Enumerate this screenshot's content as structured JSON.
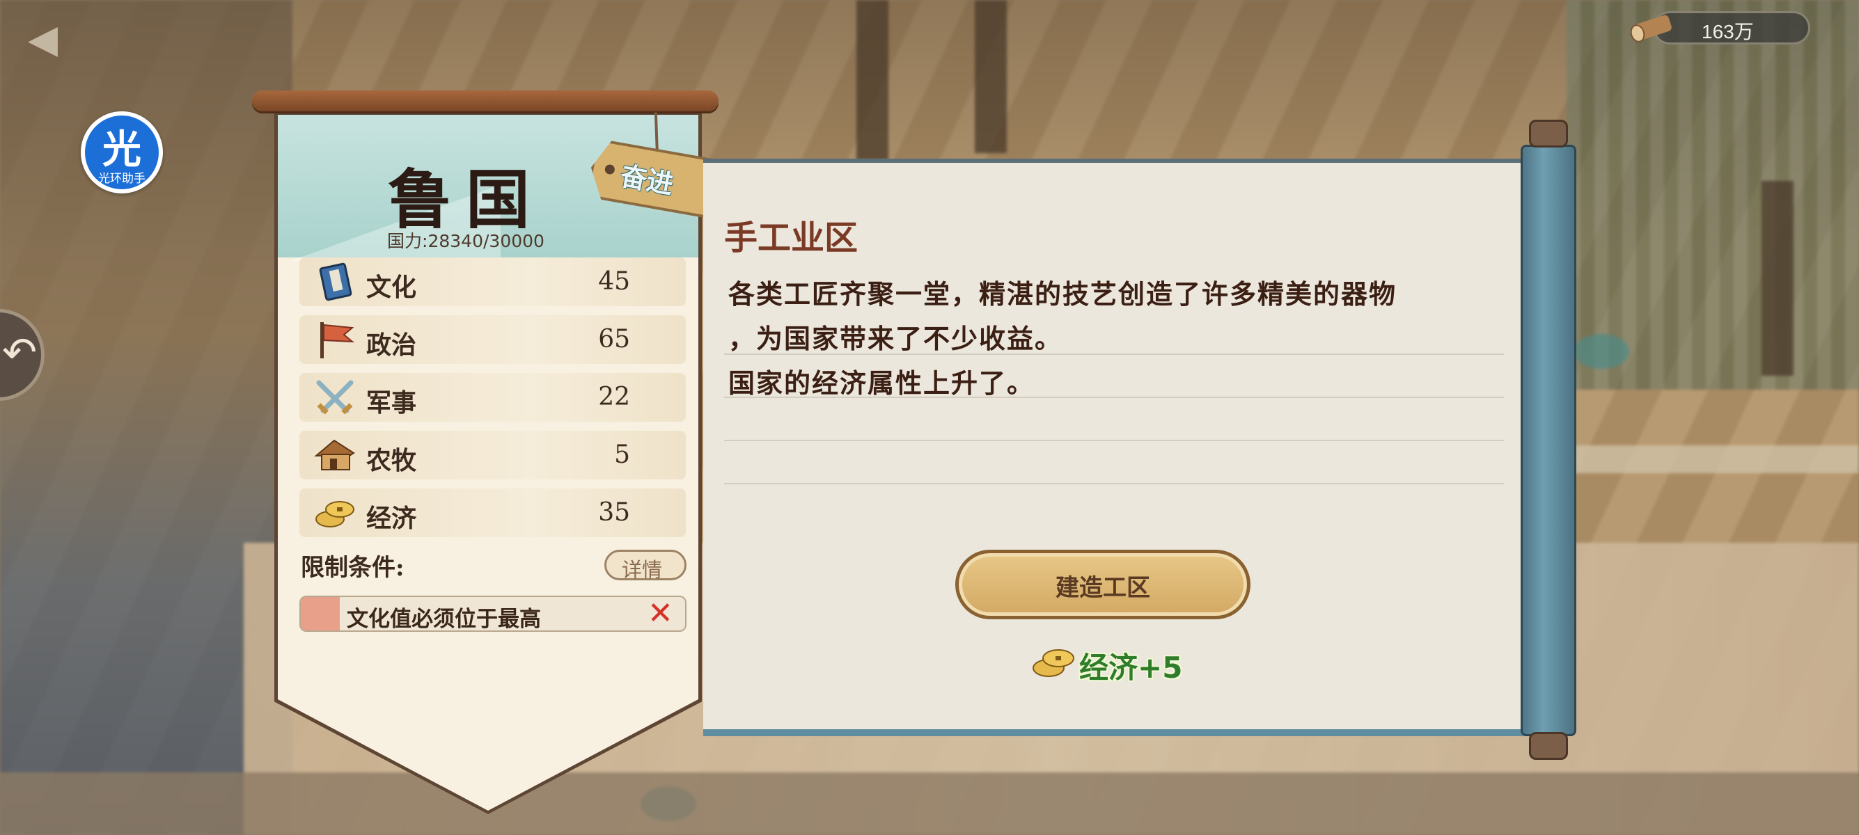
{
  "hud": {
    "resource_value": "163万",
    "resource_icon": "log-icon"
  },
  "helper": {
    "badge_char": "光",
    "badge_label": "光环助手"
  },
  "state": {
    "name": "鲁国",
    "power_text": "国力:28340/30000",
    "tag": "奋进"
  },
  "stats": [
    {
      "icon": "book-icon",
      "label": "文化",
      "value": "45"
    },
    {
      "icon": "flag-icon",
      "label": "政治",
      "value": "65"
    },
    {
      "icon": "crossed-swords-icon",
      "label": "军事",
      "value": "22"
    },
    {
      "icon": "hut-icon",
      "label": "农牧",
      "value": "5"
    },
    {
      "icon": "coins-icon",
      "label": "经济",
      "value": "35"
    }
  ],
  "limits": {
    "label": "限制条件:",
    "detail_button": "详情",
    "condition": "文化值必须位于最高",
    "condition_status": "unmet"
  },
  "district": {
    "title": "手工业区",
    "desc_line1": "各类工匠齐聚一堂，精湛的技艺创造了许多精美的器物",
    "desc_line2": "，为国家带来了不少收益。",
    "desc_line3": "国家的经济属性上升了。",
    "build_button": "建造工区",
    "reward": "经济+5"
  },
  "colors": {
    "reward_green": "#2f7d2b",
    "title_brown": "#7a3a25",
    "unmet_red": "#d6322a"
  }
}
